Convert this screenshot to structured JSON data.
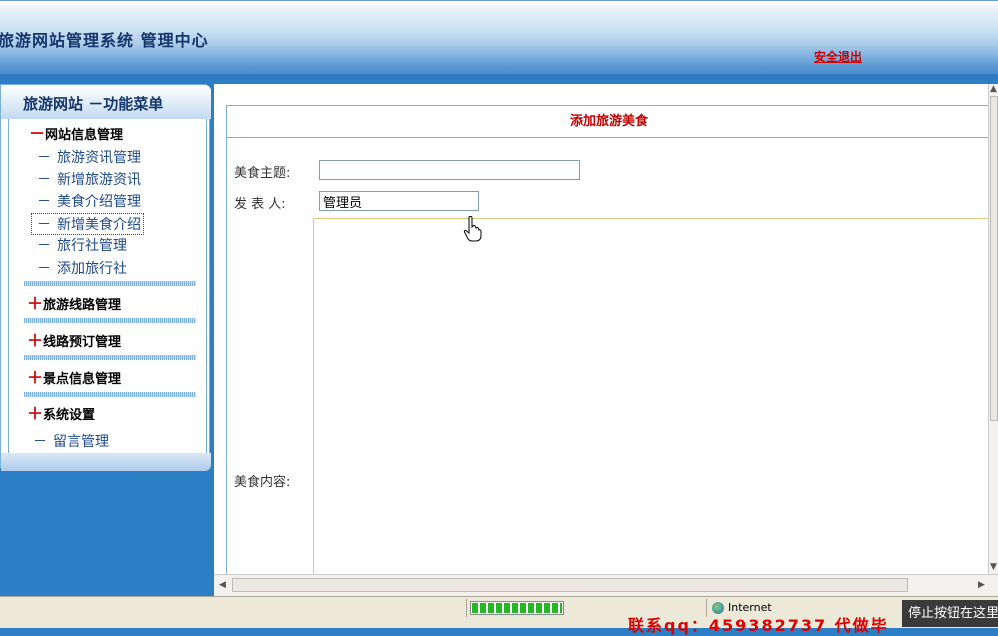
{
  "header": {
    "title": "旅游网站管理系统 管理中心",
    "logout_label": "安全退出"
  },
  "menu": {
    "title": "旅游网站 －功能菜单",
    "groups": [
      {
        "symbol": "－",
        "label": "网站信息管理",
        "expanded": true,
        "items": [
          "旅游资讯管理",
          "新增旅游资讯",
          "美食介绍管理",
          "新增美食介绍",
          "旅行社管理",
          "添加旅行社"
        ]
      },
      {
        "symbol": "＋",
        "label": "旅游线路管理",
        "expanded": false
      },
      {
        "symbol": "＋",
        "label": "线路预订管理",
        "expanded": false
      },
      {
        "symbol": "＋",
        "label": "景点信息管理",
        "expanded": false
      },
      {
        "symbol": "＋",
        "label": "系统设置",
        "expanded": false
      }
    ],
    "extra_item": "留言管理",
    "item_dash": "－"
  },
  "form": {
    "title": "添加旅游美食",
    "subject_label": "美食主题:",
    "subject_value": "",
    "author_label": "发 表 人:",
    "author_value": "管理员",
    "content_label": "美食内容:"
  },
  "statusbar": {
    "zone": "Internet",
    "progress_fraction": 1.0,
    "watermark": "联系qq：459382737 代做毕",
    "tooltip": "停止按钮在这里"
  },
  "colors": {
    "accent": "#2c7fc4",
    "title_red": "#c00000",
    "link_blue": "#1f4a8a"
  },
  "icons": [
    "hand-cursor-icon",
    "globe-icon",
    "scroll-up-icon",
    "scroll-down-icon",
    "scroll-left-icon",
    "scroll-right-icon"
  ]
}
